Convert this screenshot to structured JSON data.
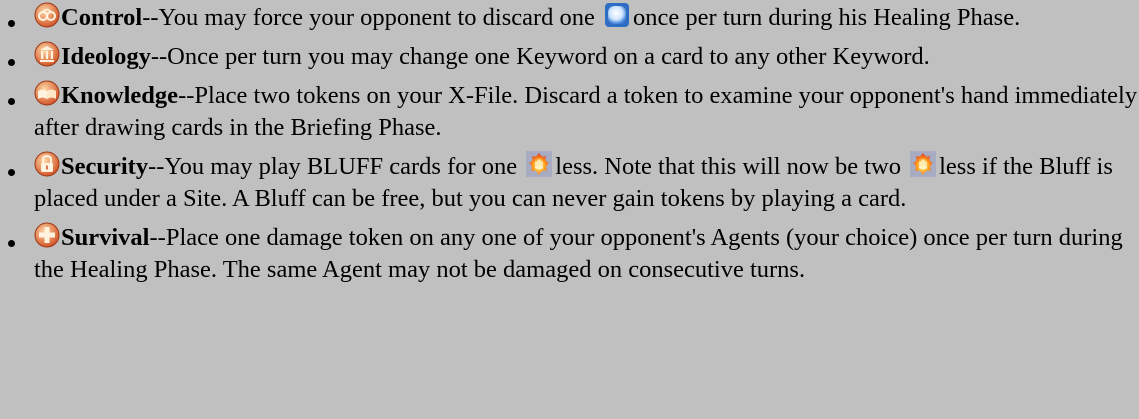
{
  "items": [
    {
      "icon": "control-agenda-icon",
      "keyword": "Control",
      "parts": [
        "--You may force your opponent to discard one",
        "once per turn during his Healing Phase."
      ],
      "inline_icon": "card-resource-icon"
    },
    {
      "icon": "ideology-agenda-icon",
      "keyword": "Ideology",
      "parts": [
        "--Once per turn you may change one Keyword on a card to any other Keyword."
      ]
    },
    {
      "icon": "knowledge-agenda-icon",
      "keyword": "Knowledge",
      "parts": [
        "--Place two tokens on your X-File. Discard a token to examine your opponent's hand immediately after drawing cards in the Briefing Phase."
      ]
    },
    {
      "icon": "security-agenda-icon",
      "keyword": "Security",
      "parts": [
        "--You may play BLUFF cards for one",
        "less. Note that this will now be two",
        "less if the Bluff is placed under a Site. A Bluff can be free, but you can never gain tokens by playing a card."
      ],
      "inline_icon": "flame-hand-token-icon"
    },
    {
      "icon": "survival-agenda-icon",
      "keyword": "Survival",
      "parts": [
        "--Place one damage token on any one of your opponent's Agents (your choice) once per turn during the Healing Phase. The same Agent may not be damaged on consecutive turns."
      ]
    }
  ]
}
